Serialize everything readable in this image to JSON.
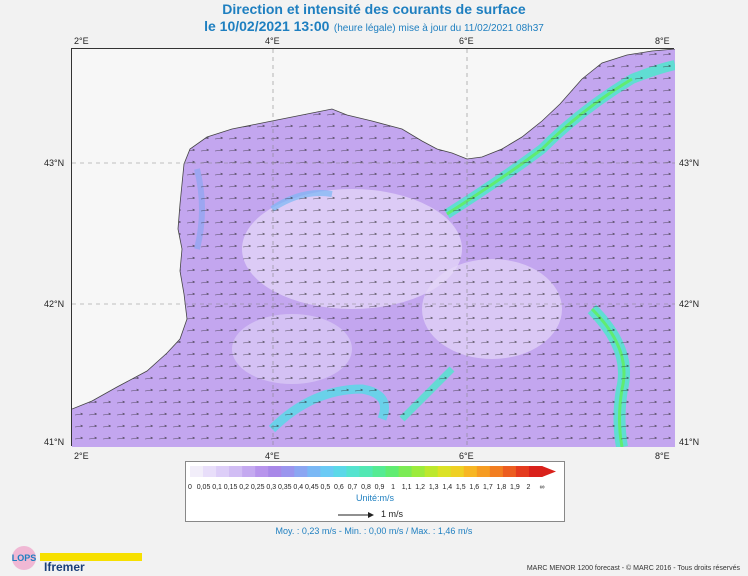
{
  "title": {
    "line1": "Direction et intensité des courants de surface",
    "datetime": "le 10/02/2021 13:00",
    "subtitle": "(heure légale) mise à jour du 11/02/2021 08h37"
  },
  "map": {
    "lon_ticks": [
      "2°E",
      "4°E",
      "6°E",
      "8°E"
    ],
    "lat_ticks": [
      "43°N",
      "42°N",
      "41°N"
    ]
  },
  "colorbar": {
    "labels": [
      "0",
      "0,05",
      "0,1",
      "0,15",
      "0,2",
      "0,25",
      "0,3",
      "0,35",
      "0,4",
      "0,45",
      "0,5",
      "0,6",
      "0,7",
      "0,8",
      "0,9",
      "1",
      "1,1",
      "1,2",
      "1,3",
      "1,4",
      "1,5",
      "1,6",
      "1,7",
      "1,8",
      "1,9",
      "2",
      "∞"
    ],
    "colors": [
      "#f2eefa",
      "#e8defa",
      "#ddcef8",
      "#d1bdf4",
      "#c4a9f0",
      "#b794ec",
      "#a888e8",
      "#9a95ee",
      "#8ba6f2",
      "#7ab8f5",
      "#6acaf5",
      "#5bd8e8",
      "#55e3cf",
      "#52e8b3",
      "#55eb93",
      "#60ec72",
      "#7ceb55",
      "#9ceb3c",
      "#bce82d",
      "#dbe226",
      "#efd024",
      "#f7b623",
      "#f69c22",
      "#f27e21",
      "#ec5d20",
      "#e43b1e",
      "#d9211b"
    ],
    "unit": "Unité:m/s",
    "scale_ref": "1 m/s"
  },
  "stats": "Moy. : 0,23 m/s   -   Min. : 0,00 m/s / Max. : 1,46 m/s",
  "credit": "MARC MENOR 1200 forecast - © MARC 2016 - Tous droits réservés",
  "logos": {
    "lops": "LOPS",
    "ifremer": "Ifremer"
  },
  "icons": {
    "vector_arrow": "arrow-icon"
  }
}
